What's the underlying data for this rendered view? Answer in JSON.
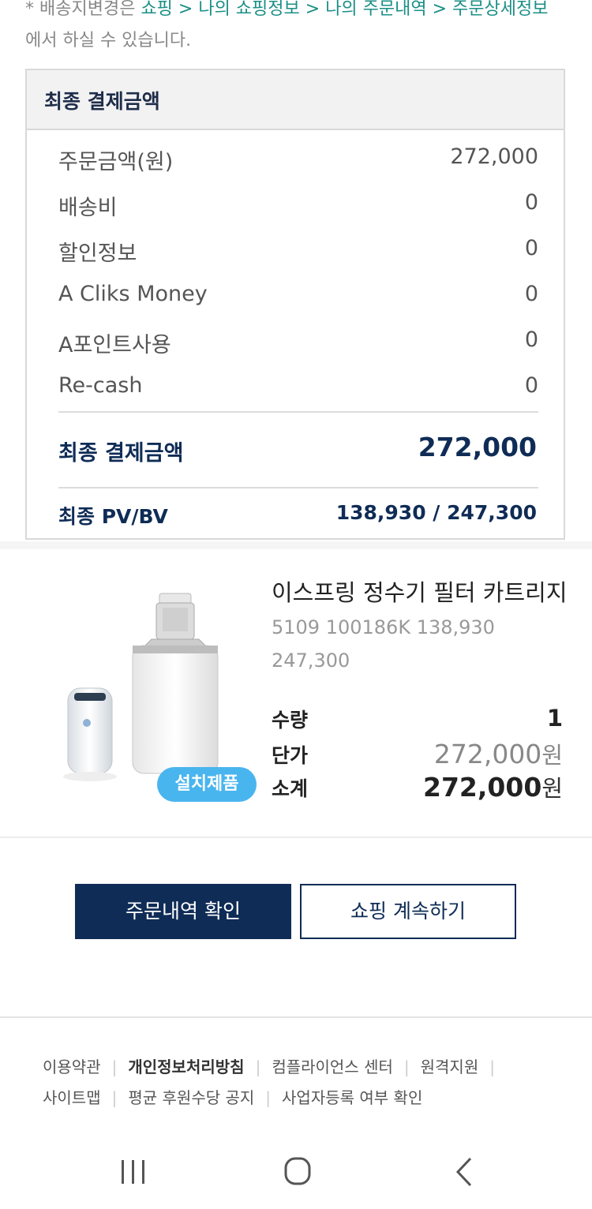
{
  "notice": {
    "prefix": "* 배송지변경은 ",
    "path": "쇼핑 > 나의 쇼핑정보 > 나의 주문내역 > 주문상세정보",
    "suffix": "에서 하실 수 있습니다."
  },
  "summary": {
    "title": "최종 결제금액",
    "rows": [
      {
        "label": "주문금액(원)",
        "value": "272,000"
      },
      {
        "label": "배송비",
        "value": "0"
      },
      {
        "label": "할인정보",
        "value": "0"
      },
      {
        "label": "A Cliks Money",
        "value": "0"
      },
      {
        "label": "A포인트사용",
        "value": "0"
      },
      {
        "label": "Re-cash",
        "value": "0"
      }
    ],
    "total_label": "최종 결제금액",
    "total_value": "272,000",
    "pv_label": "최종 PV/BV",
    "pv_value": "138,930 / 247,300"
  },
  "product": {
    "name": "이스프링 정수기 필터 카트리지",
    "meta_line1": "5109 100186K 138,930",
    "meta_line2": "247,300",
    "badge": "설치제품",
    "qty_label": "수량",
    "qty_value": "1",
    "price_label": "단가",
    "price_value": "272,000",
    "subtotal_label": "소계",
    "subtotal_value": "272,000",
    "currency": "원"
  },
  "buttons": {
    "confirm": "주문내역 확인",
    "continue": "쇼핑 계속하기"
  },
  "footer": {
    "links_row1": [
      "이용약관",
      "개인정보처리방침",
      "컴플라이언스 센터",
      "원격지원"
    ],
    "links_row2": [
      "사이트맵",
      "평균 후원수당 공지",
      "사업자등록 여부 확인"
    ]
  },
  "icons": [
    "recent-apps-icon",
    "home-icon",
    "back-icon"
  ]
}
